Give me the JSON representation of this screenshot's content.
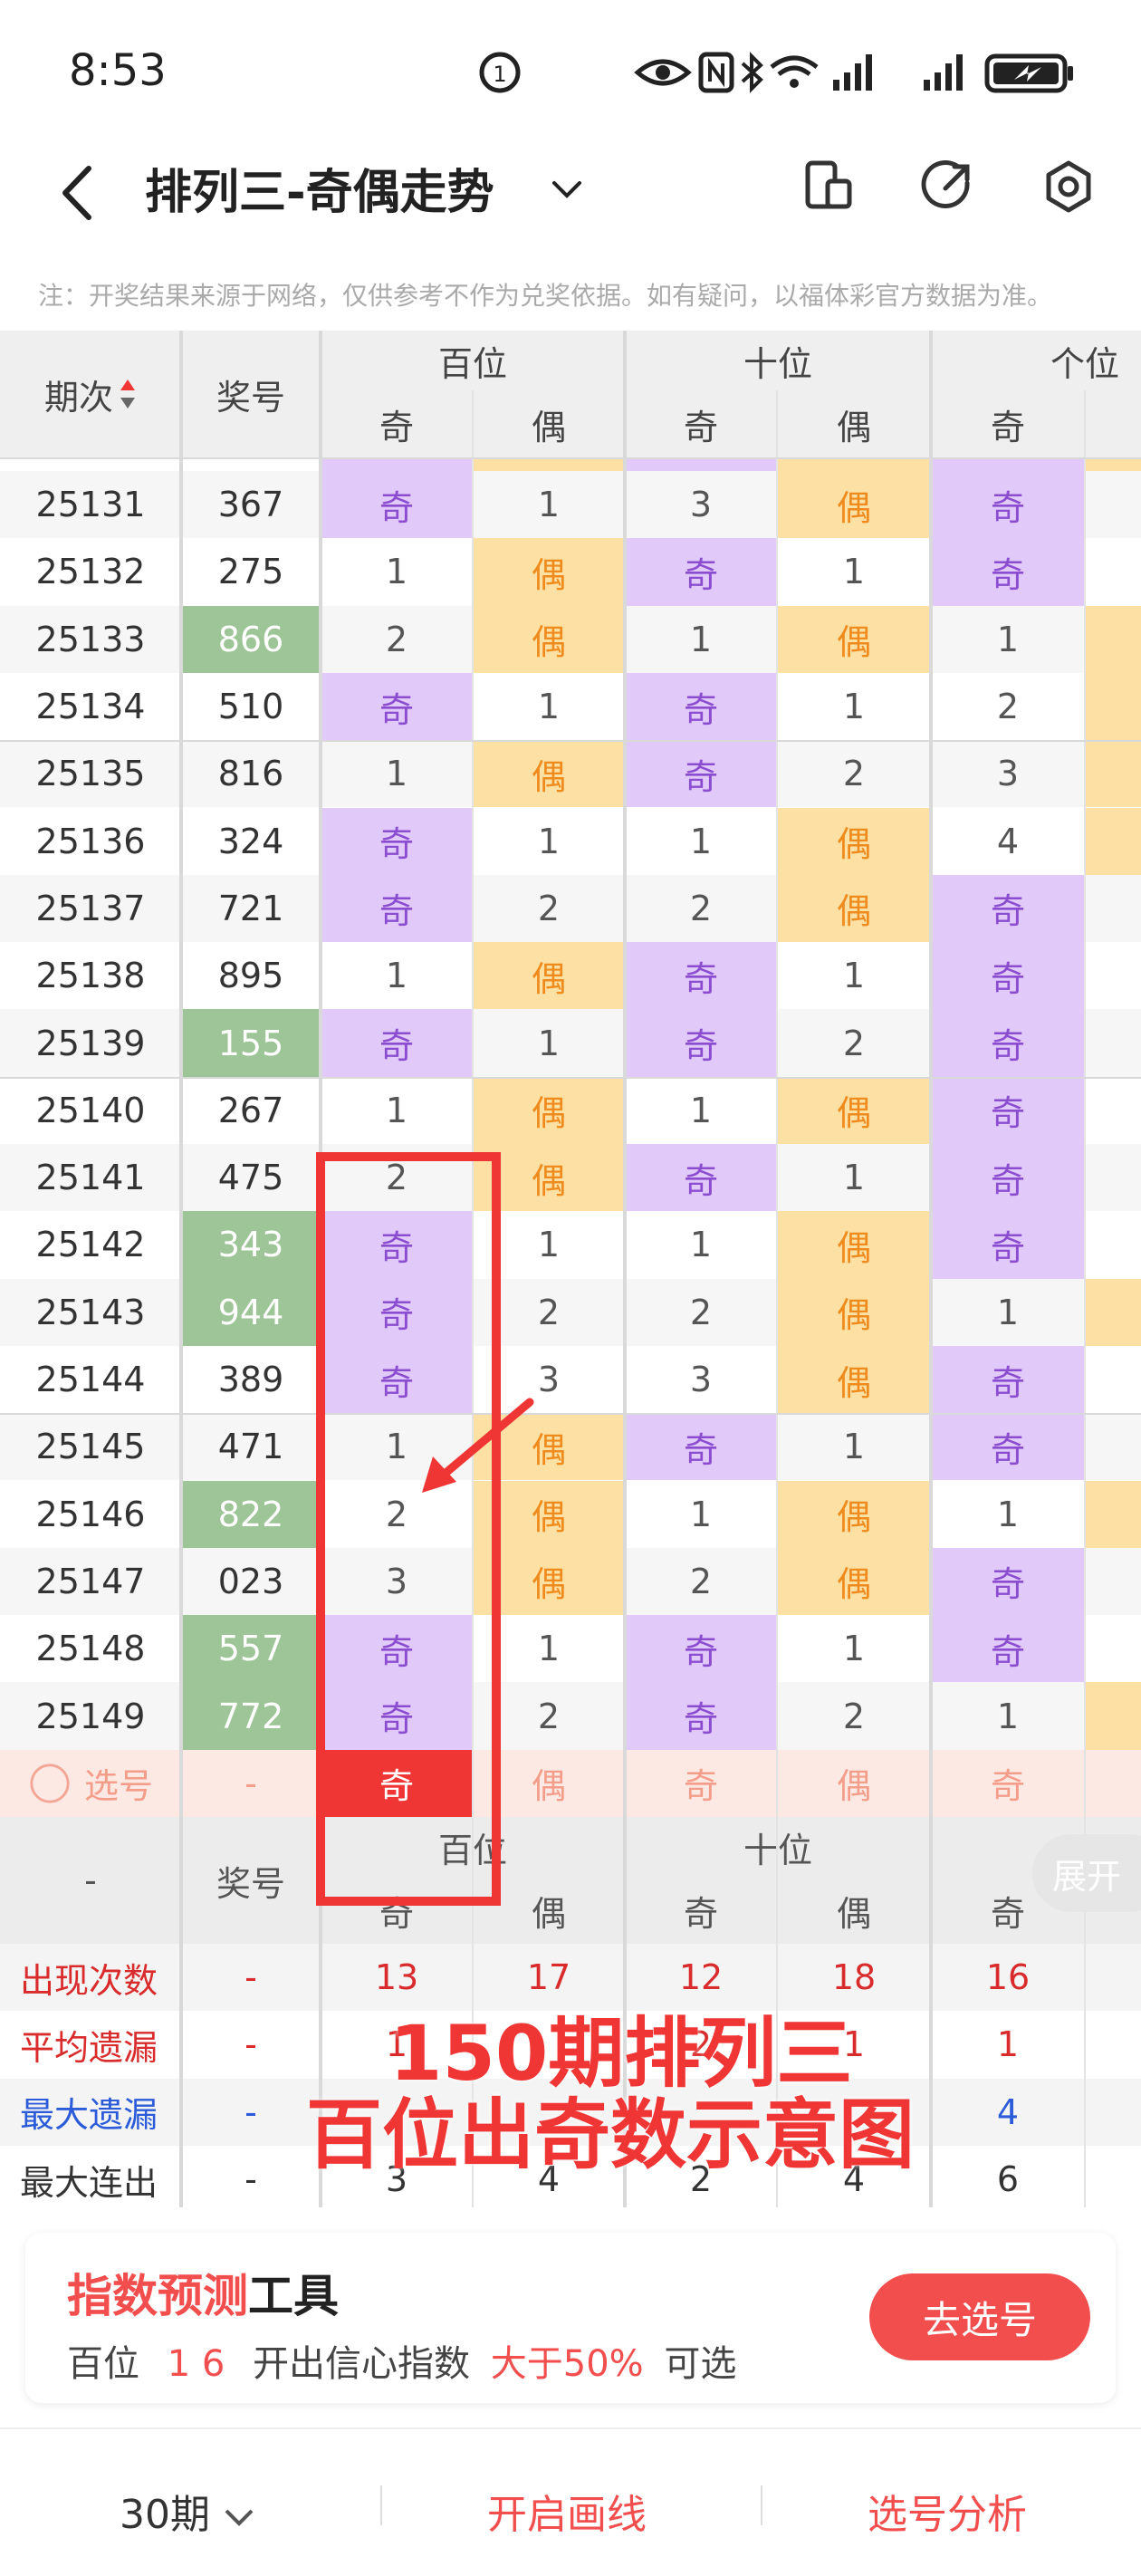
{
  "status_bar": {
    "time": "8:53"
  },
  "header": {
    "title": "排列三-奇偶走势"
  },
  "notice": "注：开奖结果来源于网络，仅供参考不作为兑奖依据。如有疑问，以福体彩官方数据为准。",
  "table": {
    "col_period": "期次",
    "col_number": "奖号",
    "groups": [
      "百位",
      "十位",
      "个位"
    ],
    "sub_odd": "奇",
    "sub_even": "偶",
    "rows": [
      {
        "period": "25131",
        "number": "367",
        "hl": false,
        "h": [
          "odd",
          "1"
        ],
        "t": [
          "3",
          "even"
        ],
        "u": "odd"
      },
      {
        "period": "25132",
        "number": "275",
        "hl": false,
        "h": [
          "1",
          "even"
        ],
        "t": [
          "odd",
          "1"
        ],
        "u": "odd"
      },
      {
        "period": "25133",
        "number": "866",
        "hl": true,
        "h": [
          "2",
          "even"
        ],
        "t": [
          "1",
          "even"
        ],
        "u": "1"
      },
      {
        "period": "25134",
        "number": "510",
        "hl": false,
        "h": [
          "odd",
          "1"
        ],
        "t": [
          "odd",
          "1"
        ],
        "u": "2"
      },
      {
        "period": "25135",
        "number": "816",
        "hl": false,
        "h": [
          "1",
          "even"
        ],
        "t": [
          "odd",
          "2"
        ],
        "u": "3"
      },
      {
        "period": "25136",
        "number": "324",
        "hl": false,
        "h": [
          "odd",
          "1"
        ],
        "t": [
          "1",
          "even"
        ],
        "u": "4"
      },
      {
        "period": "25137",
        "number": "721",
        "hl": false,
        "h": [
          "odd",
          "2"
        ],
        "t": [
          "2",
          "even"
        ],
        "u": "odd"
      },
      {
        "period": "25138",
        "number": "895",
        "hl": false,
        "h": [
          "1",
          "even"
        ],
        "t": [
          "odd",
          "1"
        ],
        "u": "odd"
      },
      {
        "period": "25139",
        "number": "155",
        "hl": true,
        "h": [
          "odd",
          "1"
        ],
        "t": [
          "odd",
          "2"
        ],
        "u": "odd"
      },
      {
        "period": "25140",
        "number": "267",
        "hl": false,
        "h": [
          "1",
          "even"
        ],
        "t": [
          "1",
          "even"
        ],
        "u": "odd"
      },
      {
        "period": "25141",
        "number": "475",
        "hl": false,
        "h": [
          "2",
          "even"
        ],
        "t": [
          "odd",
          "1"
        ],
        "u": "odd"
      },
      {
        "period": "25142",
        "number": "343",
        "hl": true,
        "h": [
          "odd",
          "1"
        ],
        "t": [
          "1",
          "even"
        ],
        "u": "odd"
      },
      {
        "period": "25143",
        "number": "944",
        "hl": true,
        "h": [
          "odd",
          "2"
        ],
        "t": [
          "2",
          "even"
        ],
        "u": "1"
      },
      {
        "period": "25144",
        "number": "389",
        "hl": false,
        "h": [
          "odd",
          "3"
        ],
        "t": [
          "3",
          "even"
        ],
        "u": "odd"
      },
      {
        "period": "25145",
        "number": "471",
        "hl": false,
        "h": [
          "1",
          "even"
        ],
        "t": [
          "odd",
          "1"
        ],
        "u": "odd"
      },
      {
        "period": "25146",
        "number": "822",
        "hl": true,
        "h": [
          "2",
          "even"
        ],
        "t": [
          "1",
          "even"
        ],
        "u": "1"
      },
      {
        "period": "25147",
        "number": "023",
        "hl": false,
        "h": [
          "3",
          "even"
        ],
        "t": [
          "2",
          "even"
        ],
        "u": "odd"
      },
      {
        "period": "25148",
        "number": "557",
        "hl": true,
        "h": [
          "odd",
          "1"
        ],
        "t": [
          "odd",
          "1"
        ],
        "u": "odd"
      },
      {
        "period": "25149",
        "number": "772",
        "hl": true,
        "h": [
          "odd",
          "2"
        ],
        "t": [
          "odd",
          "2"
        ],
        "u": "1"
      }
    ],
    "select_row": {
      "label": "选号",
      "number": "-"
    },
    "footer_dash": "-",
    "stats": [
      {
        "label": "出现次数",
        "dash": "-",
        "values": [
          "13",
          "17",
          "12",
          "18",
          "16"
        ],
        "color": "#d92b2b"
      },
      {
        "label": "平均遗漏",
        "dash": "-",
        "values": [
          "1",
          "",
          "2",
          "1",
          "1"
        ],
        "color": "#d92b2b"
      },
      {
        "label": "最大遗漏",
        "dash": "-",
        "values": [
          "",
          "",
          "",
          "",
          "4"
        ],
        "color": "#2b5bd9"
      },
      {
        "label": "最大连出",
        "dash": "-",
        "values": [
          "3",
          "4",
          "2",
          "4",
          "6"
        ],
        "color": "#333"
      }
    ]
  },
  "overlay": {
    "line1": "150期排列三",
    "line2": "百位出奇数示意图",
    "color": "#f03535"
  },
  "expand_label": "展开",
  "tool_card": {
    "title_red": "指数预测",
    "title_black": "工具",
    "sub_a": "百位",
    "sub_b": "1 6",
    "sub_c": "开出信心指数",
    "sub_d": "大于50%",
    "sub_e": "可选",
    "button": "去选号"
  },
  "bottom_bar": {
    "periods": "30期",
    "draw_line": "开启画线",
    "analysis": "选号分析"
  },
  "colors": {
    "accent": "#f24e4e",
    "odd_bg": "#e1c9fa",
    "even_bg": "#fde1a4",
    "highlight": "#9ec597"
  }
}
